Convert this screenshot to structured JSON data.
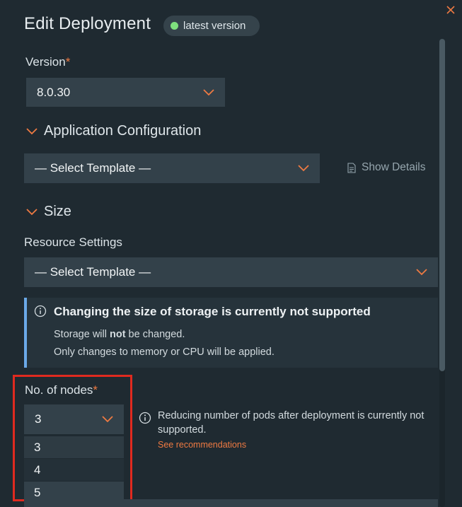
{
  "header": {
    "title": "Edit Deployment",
    "badge": "latest version"
  },
  "colors": {
    "accent": "#ef7a42",
    "background": "#1f2a31",
    "field": "#33414a",
    "info_bar": "#6ba9e8",
    "status_dot": "#7fe07e",
    "highlight": "#e02a1f"
  },
  "version": {
    "label": "Version",
    "required": "*",
    "value": "8.0.30"
  },
  "app_config": {
    "section_label": "Application Configuration",
    "select_value": "— Select Template —",
    "show_details": "Show Details"
  },
  "size": {
    "section_label": "Size",
    "resource_label": "Resource Settings",
    "select_value": "— Select Template —",
    "alert": {
      "heading": "Changing the size of storage is currently not supported",
      "line1_pre": "Storage will ",
      "line1_bold": "not",
      "line1_post": " be changed.",
      "line2": "Only changes to memory or CPU will be applied."
    }
  },
  "nodes": {
    "label": "No. of nodes",
    "required": "*",
    "value": "3",
    "options": [
      "3",
      "4",
      "5"
    ],
    "hint": "Reducing number of pods after deployment is currently not supported.",
    "link": "See recommendations"
  },
  "icons": [
    "close-icon",
    "chevron-down-icon",
    "document-icon",
    "info-icon"
  ]
}
